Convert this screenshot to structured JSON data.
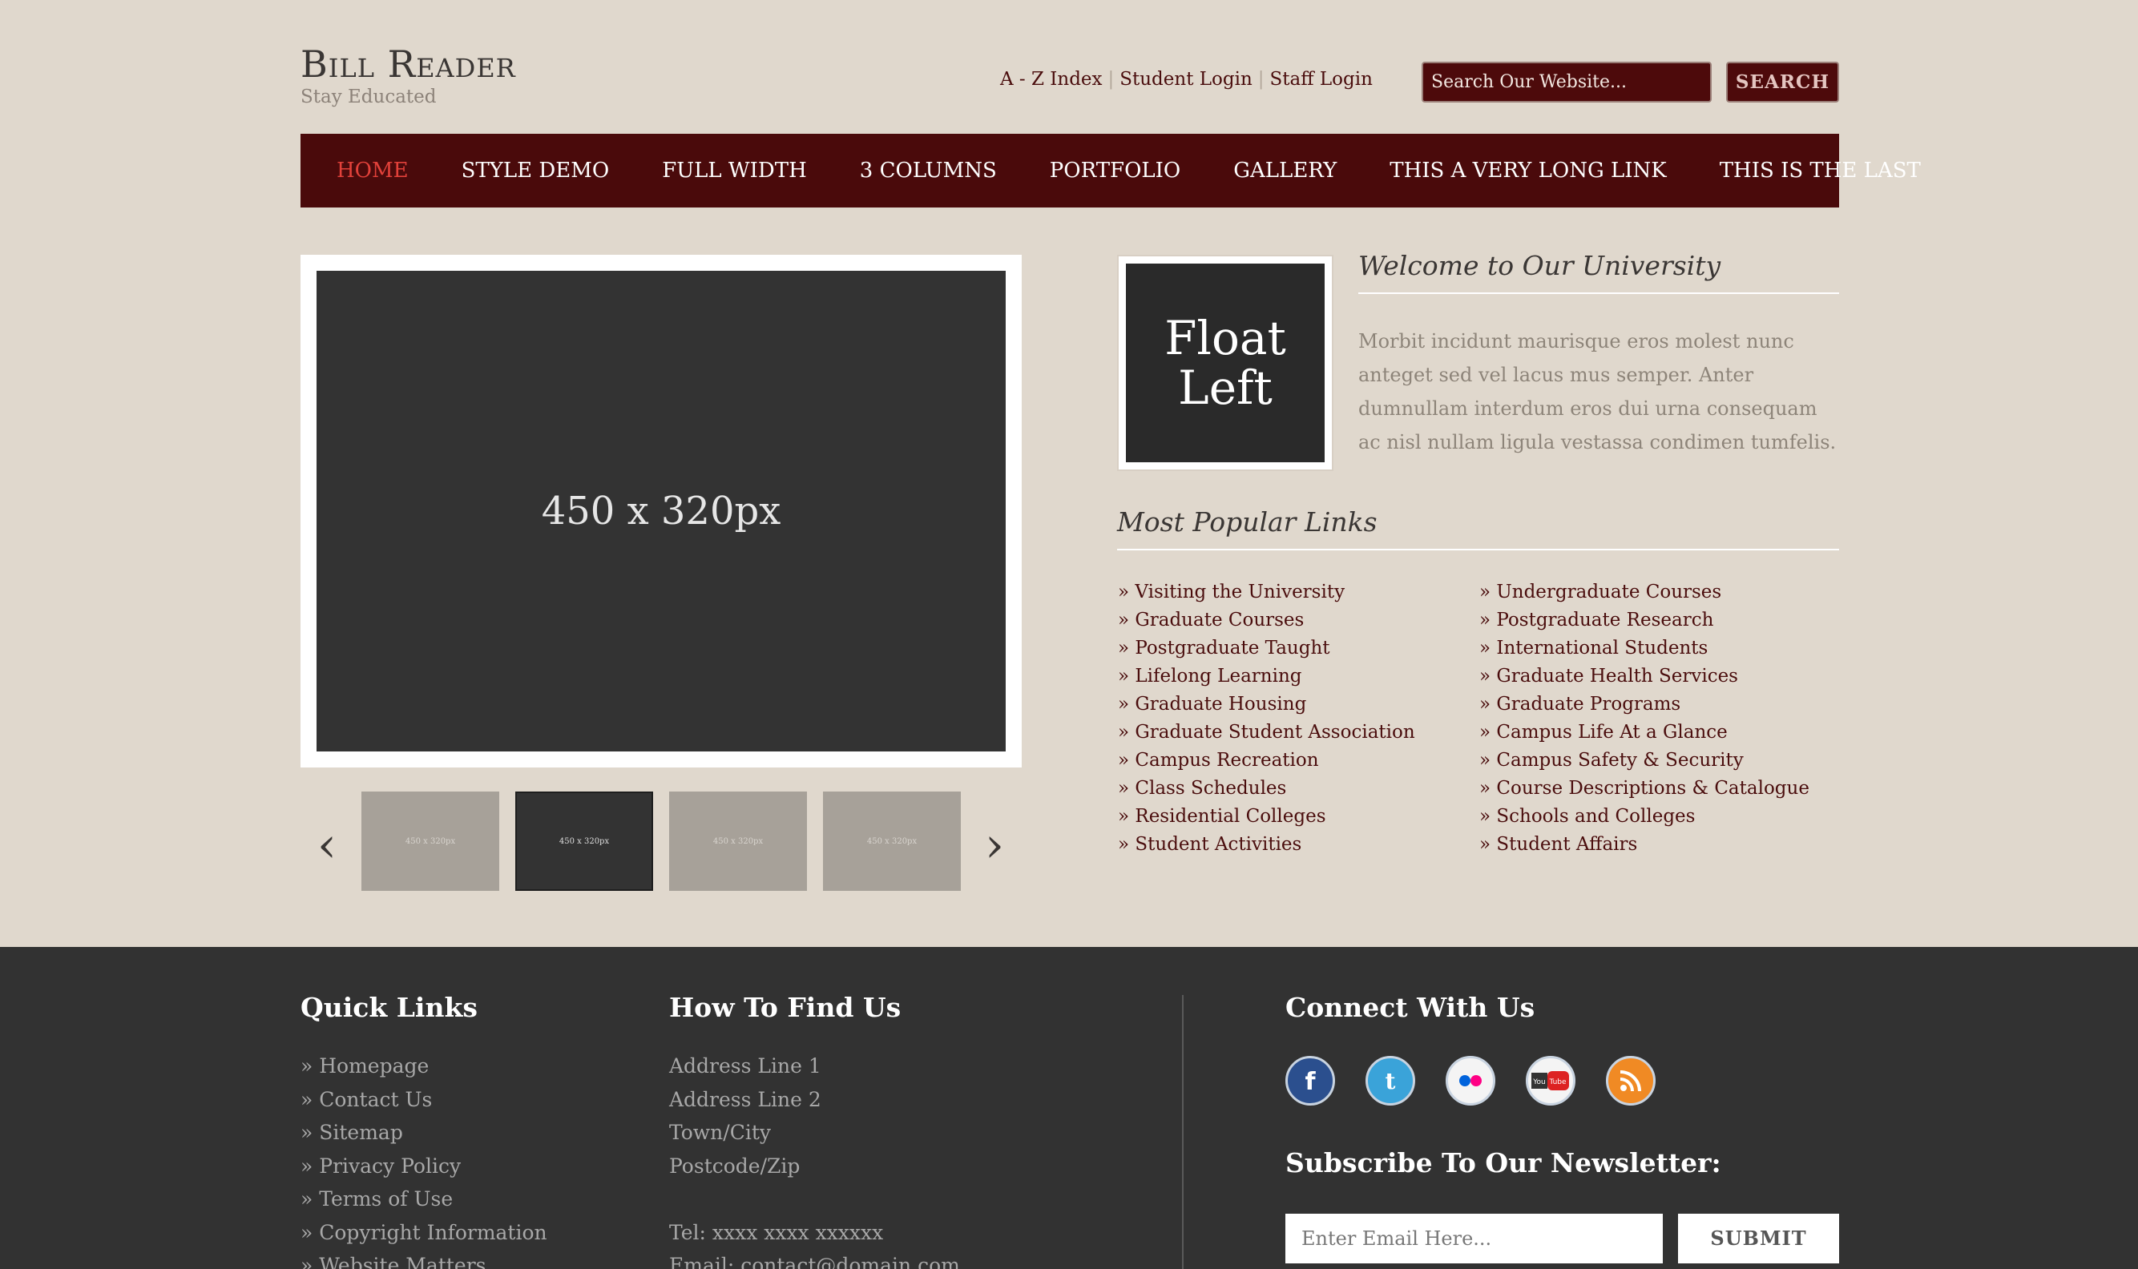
{
  "header": {
    "title": "Bill Reader",
    "tagline": "Stay Educated",
    "top_links": [
      "A - Z Index",
      "Student Login",
      "Staff Login"
    ],
    "search_placeholder": "Search Our Website...",
    "search_button": "SEARCH"
  },
  "nav": {
    "items": [
      "HOME",
      "STYLE DEMO",
      "FULL WIDTH",
      "3 COLUMNS",
      "PORTFOLIO",
      "GALLERY",
      "THIS A VERY LONG LINK",
      "THIS IS THE LAST"
    ],
    "active_index": 0
  },
  "slider": {
    "main_label": "450 x 320px",
    "thumbs": [
      "450 x 320px",
      "450 x 320px",
      "450 x 320px",
      "450 x 320px"
    ],
    "active_thumb": 1,
    "prev": "‹",
    "next": "›"
  },
  "welcome": {
    "image_label_line1": "Float",
    "image_label_line2": "Left",
    "title": "Welcome to Our University",
    "text": "Morbit incidunt maurisque eros molest nunc anteget sed vel lacus mus semper. Anter dumnullam interdum eros dui urna consequam ac nisl nullam ligula vestassa condimen tumfelis."
  },
  "popular": {
    "title": "Most Popular Links",
    "left": [
      "» Visiting the University",
      "» Graduate Courses",
      "» Postgraduate Taught",
      "» Lifelong Learning",
      "» Graduate Housing",
      "» Graduate Student Association",
      "» Campus Recreation",
      "» Class Schedules",
      "» Residential Colleges",
      "» Student Activities"
    ],
    "right": [
      "» Undergraduate Courses",
      "» Postgraduate Research",
      "» International Students",
      "» Graduate Health Services",
      "» Graduate Programs",
      "» Campus Life At a Glance",
      "» Campus Safety & Security",
      "» Course Descriptions & Catalogue",
      "» Schools and Colleges",
      "» Student Affairs"
    ]
  },
  "footer": {
    "quick_links_title": "Quick Links",
    "quick_links": [
      "» Homepage",
      "» Contact Us",
      "» Sitemap",
      "» Privacy Policy",
      "» Terms of Use",
      "» Copyright Information",
      "» Website Matters"
    ],
    "find_title": "How To Find Us",
    "find_lines": [
      "Address Line 1",
      "Address Line 2",
      "Town/City",
      "Postcode/Zip",
      "",
      "Tel: xxxx xxxx xxxxxx",
      "Email: contact@domain.com"
    ],
    "connect_title": "Connect With Us",
    "social": [
      "facebook-icon",
      "twitter-icon",
      "flickr-icon",
      "youtube-icon",
      "rss-icon"
    ],
    "newsletter_title": "Subscribe To Our Newsletter:",
    "email_placeholder": "Enter Email Here...",
    "submit": "SUBMIT"
  },
  "colors": {
    "accent": "#4a0a0b",
    "active_nav": "#e2413a",
    "background": "#e0d8cd",
    "footer": "#323232"
  }
}
